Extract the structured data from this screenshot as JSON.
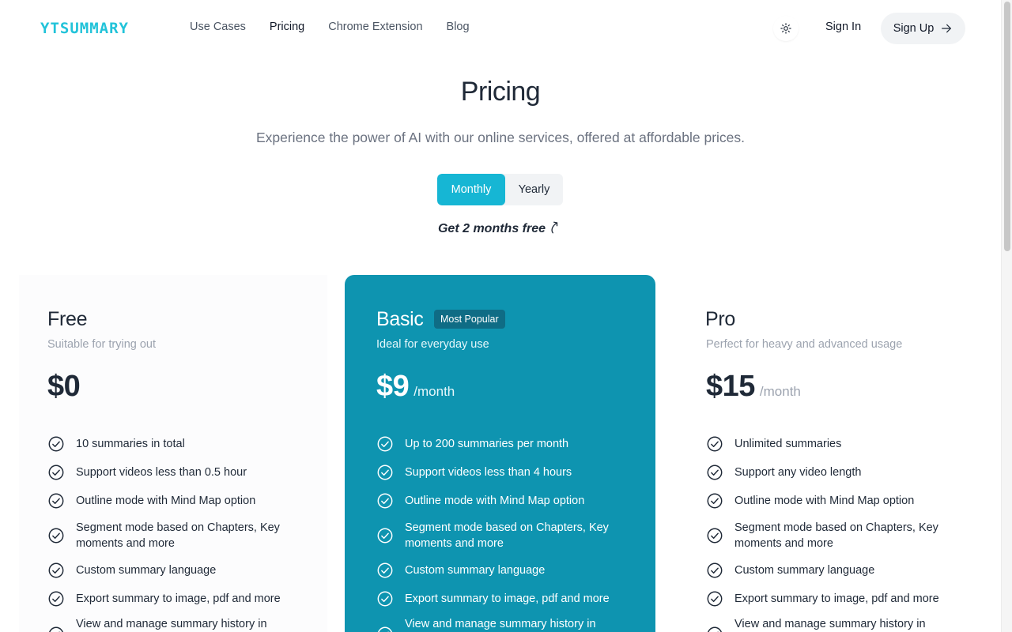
{
  "brand": {
    "logo_text": "YTSUMMARY",
    "accent": "#16b6d4"
  },
  "nav": [
    {
      "label": "Use Cases",
      "active": false
    },
    {
      "label": "Pricing",
      "active": true
    },
    {
      "label": "Chrome Extension",
      "active": false
    },
    {
      "label": "Blog",
      "active": false
    }
  ],
  "header": {
    "theme_icon": "sun-icon",
    "signin_label": "Sign In",
    "signup_label": "Sign Up",
    "signup_icon": "arrow-right-icon"
  },
  "hero": {
    "title": "Pricing",
    "subtitle": "Experience the power of AI with our online services, offered at affordable prices.",
    "toggle": {
      "monthly": "Monthly",
      "yearly": "Yearly",
      "selected": "Monthly"
    },
    "promo": "Get 2 months free"
  },
  "plans": [
    {
      "name": "Free",
      "desc": "Suitable for trying out",
      "price": "$0",
      "period": "",
      "features": [
        "10 summaries in total",
        "Support videos less than 0.5 hour",
        "Outline mode with Mind Map option",
        "Segment mode based on Chapters, Key moments and more",
        "Custom summary language",
        "Export summary to image, pdf and more",
        "View and manage summary history in"
      ]
    },
    {
      "name": "Basic",
      "badge": "Most Popular",
      "desc": "Ideal for everyday use",
      "price": "$9",
      "period": "/month",
      "features": [
        "Up to 200 summaries per month",
        "Support videos less than 4 hours",
        "Outline mode with Mind Map option",
        "Segment mode based on Chapters, Key moments and more",
        "Custom summary language",
        "Export summary to image, pdf and more",
        "View and manage summary history in"
      ]
    },
    {
      "name": "Pro",
      "desc": "Perfect for heavy and advanced usage",
      "price": "$15",
      "period": "/month",
      "features": [
        "Unlimited summaries",
        "Support any video length",
        "Outline mode with Mind Map option",
        "Segment mode based on Chapters, Key moments and more",
        "Custom summary language",
        "Export summary to image, pdf and more",
        "View and manage summary history in"
      ]
    }
  ]
}
